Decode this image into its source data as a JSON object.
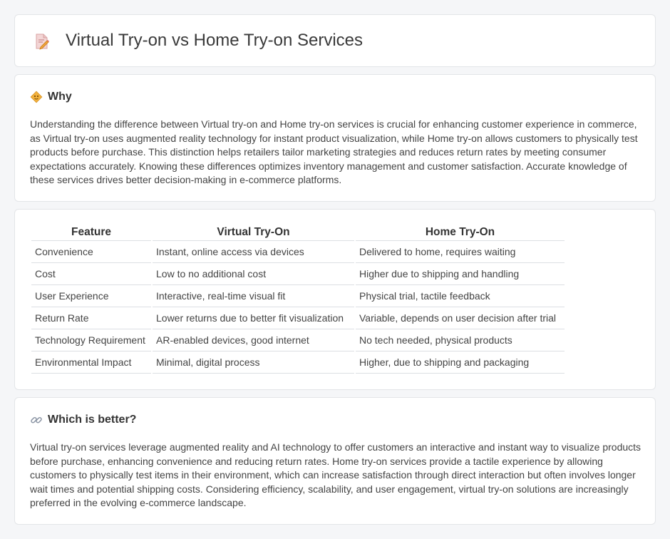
{
  "header": {
    "title": "Virtual Try-on vs Home Try-on Services",
    "icon": "document-pencil-icon"
  },
  "why": {
    "heading": "Why",
    "icon": "warning-diamond-icon",
    "text": "Understanding the difference between Virtual try-on and Home try-on services is crucial for enhancing customer experience in commerce, as Virtual try-on uses augmented reality technology for instant product visualization, while Home try-on allows customers to physically test products before purchase. This distinction helps retailers tailor marketing strategies and reduces return rates by meeting consumer expectations accurately. Knowing these differences optimizes inventory management and customer satisfaction. Accurate knowledge of these services drives better decision-making in e-commerce platforms."
  },
  "table": {
    "headers": [
      "Feature",
      "Virtual Try-On",
      "Home Try-On"
    ],
    "rows": [
      [
        "Convenience",
        "Instant, online access via devices",
        "Delivered to home, requires waiting"
      ],
      [
        "Cost",
        "Low to no additional cost",
        "Higher due to shipping and handling"
      ],
      [
        "User Experience",
        "Interactive, real-time visual fit",
        "Physical trial, tactile feedback"
      ],
      [
        "Return Rate",
        "Lower returns due to better fit visualization",
        "Variable, depends on user decision after trial"
      ],
      [
        "Technology Requirement",
        "AR-enabled devices, good internet",
        "No tech needed, physical products"
      ],
      [
        "Environmental Impact",
        "Minimal, digital process",
        "Higher, due to shipping and packaging"
      ]
    ]
  },
  "better": {
    "heading": "Which is better?",
    "icon": "link-icon",
    "text": "Virtual try-on services leverage augmented reality and AI technology to offer customers an interactive and instant way to visualize products before purchase, enhancing convenience and reducing return rates. Home try-on services provide a tactile experience by allowing customers to physically test items in their environment, which can increase satisfaction through direct interaction but often involves longer wait times and potential shipping costs. Considering efficiency, scalability, and user engagement, virtual try-on solutions are increasingly preferred in the evolving e-commerce landscape."
  }
}
